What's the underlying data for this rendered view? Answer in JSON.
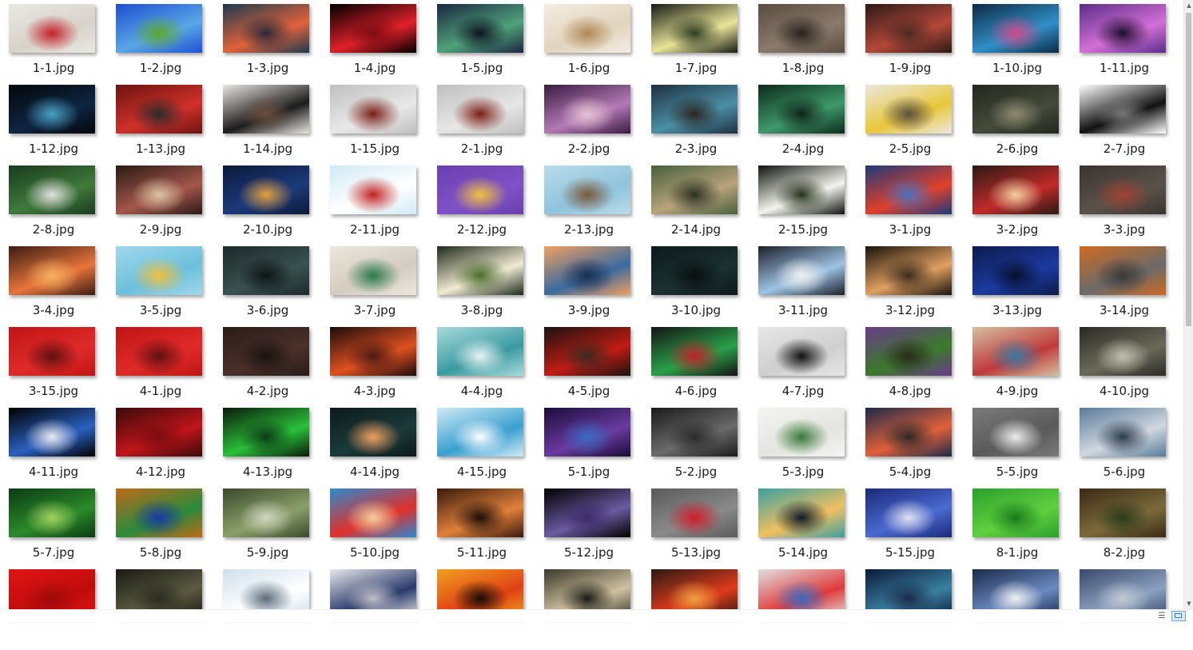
{
  "window": {
    "view": "Large icons"
  },
  "files": [
    {
      "name": "1-1.jpg",
      "colors": [
        "#e9e8e3",
        "#d7d3c9",
        "#c4202a"
      ]
    },
    {
      "name": "1-2.jpg",
      "colors": [
        "#1d4fd3",
        "#5aa6e6",
        "#5ca831"
      ]
    },
    {
      "name": "1-3.jpg",
      "colors": [
        "#1b3a4f",
        "#e0623a",
        "#2a2a3a"
      ]
    },
    {
      "name": "1-4.jpg",
      "colors": [
        "#000000",
        "#e0202a",
        "#7a0d12"
      ]
    },
    {
      "name": "1-5.jpg",
      "colors": [
        "#1a2740",
        "#4fa27a",
        "#0d1320"
      ]
    },
    {
      "name": "1-6.jpg",
      "colors": [
        "#f3ede3",
        "#e2d4bd",
        "#b08a57"
      ]
    },
    {
      "name": "1-7.jpg",
      "colors": [
        "#161b14",
        "#e9e49a",
        "#2c3a1f"
      ]
    },
    {
      "name": "1-8.jpg",
      "colors": [
        "#5a4b40",
        "#8a7a6c",
        "#2a221c"
      ]
    },
    {
      "name": "1-9.jpg",
      "colors": [
        "#2b1a14",
        "#b5473a",
        "#4a2a22"
      ]
    },
    {
      "name": "1-10.jpg",
      "colors": [
        "#0e2a44",
        "#2f8fc7",
        "#d04a8a"
      ]
    },
    {
      "name": "1-11.jpg",
      "colors": [
        "#5c2d8a",
        "#d36fd6",
        "#1c0d2a"
      ]
    },
    {
      "name": "1-12.jpg",
      "colors": [
        "#04060c",
        "#0e2540",
        "#4aa0c6"
      ]
    },
    {
      "name": "1-13.jpg",
      "colors": [
        "#6a1410",
        "#d2302a",
        "#2a2a2a"
      ]
    },
    {
      "name": "1-14.jpg",
      "colors": [
        "#e9e6e1",
        "#1c1c1c",
        "#6a5040"
      ]
    },
    {
      "name": "1-15.jpg",
      "colors": [
        "#bfbfbf",
        "#e8e8e8",
        "#7a1c14"
      ]
    },
    {
      "name": "2-1.jpg",
      "colors": [
        "#bfbfbf",
        "#e6e6e6",
        "#7a1c14"
      ]
    },
    {
      "name": "2-2.jpg",
      "colors": [
        "#3a1a40",
        "#b37ab5",
        "#e6c2d4"
      ]
    },
    {
      "name": "2-3.jpg",
      "colors": [
        "#1d3040",
        "#4b8fa6",
        "#2a2520"
      ]
    },
    {
      "name": "2-4.jpg",
      "colors": [
        "#0c2a1c",
        "#3d9a6a",
        "#10231a"
      ]
    },
    {
      "name": "2-5.jpg",
      "colors": [
        "#ece7df",
        "#e8c73a",
        "#5a4f40"
      ]
    },
    {
      "name": "2-6.jpg",
      "colors": [
        "#22271f",
        "#454a3a",
        "#8c8a70"
      ]
    },
    {
      "name": "2-7.jpg",
      "colors": [
        "#ffffff",
        "#111111",
        "#777777"
      ]
    },
    {
      "name": "2-8.jpg",
      "colors": [
        "#1a3a20",
        "#3f7a3a",
        "#e0e0e0"
      ]
    },
    {
      "name": "2-9.jpg",
      "colors": [
        "#2a1a14",
        "#a4564a",
        "#d9c3a2"
      ]
    },
    {
      "name": "2-10.jpg",
      "colors": [
        "#0b1a3a",
        "#1c3a7a",
        "#e0a040"
      ]
    },
    {
      "name": "2-11.jpg",
      "colors": [
        "#cfeaf6",
        "#ffffff",
        "#c02020"
      ]
    },
    {
      "name": "2-12.jpg",
      "colors": [
        "#6a3fb0",
        "#7e52c4",
        "#f0c040"
      ]
    },
    {
      "name": "2-13.jpg",
      "colors": [
        "#b9dcec",
        "#8fc4dc",
        "#7a5a3a"
      ]
    },
    {
      "name": "2-14.jpg",
      "colors": [
        "#48603a",
        "#b7a37c",
        "#2a3020"
      ]
    },
    {
      "name": "2-15.jpg",
      "colors": [
        "#10140e",
        "#f4f4ee",
        "#233018"
      ]
    },
    {
      "name": "3-1.jpg",
      "colors": [
        "#1c3a7a",
        "#e0402a",
        "#4a70c0"
      ]
    },
    {
      "name": "3-2.jpg",
      "colors": [
        "#2a1a14",
        "#c02a2a",
        "#f0d0a0"
      ]
    },
    {
      "name": "3-3.jpg",
      "colors": [
        "#3a3430",
        "#5a524a",
        "#a04030"
      ]
    },
    {
      "name": "3-4.jpg",
      "colors": [
        "#3a1c14",
        "#e8743a",
        "#f4b060"
      ]
    },
    {
      "name": "3-5.jpg",
      "colors": [
        "#9fd8ec",
        "#6cc0dc",
        "#f0c040"
      ]
    },
    {
      "name": "3-6.jpg",
      "colors": [
        "#1c2a2a",
        "#3a5050",
        "#0c1414"
      ]
    },
    {
      "name": "3-7.jpg",
      "colors": [
        "#ece6dc",
        "#d4ccc0",
        "#2a7a4a"
      ]
    },
    {
      "name": "3-8.jpg",
      "colors": [
        "#1e2a1a",
        "#f0ead2",
        "#4a6a2a"
      ]
    },
    {
      "name": "3-9.jpg",
      "colors": [
        "#f0a060",
        "#3a6aa0",
        "#1c3050"
      ]
    },
    {
      "name": "3-10.jpg",
      "colors": [
        "#0c1a1c",
        "#1c3030",
        "#06100e"
      ]
    },
    {
      "name": "3-11.jpg",
      "colors": [
        "#1a1e2a",
        "#9ec4e4",
        "#f0f0f0"
      ]
    },
    {
      "name": "3-12.jpg",
      "colors": [
        "#1a120e",
        "#e0a060",
        "#3a2a1c"
      ]
    },
    {
      "name": "3-13.jpg",
      "colors": [
        "#0c1a4a",
        "#1c3aa0",
        "#06102a"
      ]
    },
    {
      "name": "3-14.jpg",
      "colors": [
        "#d06a20",
        "#6a6a6a",
        "#3a3a3a"
      ]
    },
    {
      "name": "3-15.jpg",
      "colors": [
        "#c01414",
        "#e02a2a",
        "#601010"
      ]
    },
    {
      "name": "4-1.jpg",
      "colors": [
        "#c01414",
        "#e02a2a",
        "#601010"
      ]
    },
    {
      "name": "4-2.jpg",
      "colors": [
        "#2a1c18",
        "#4a302a",
        "#1a1210"
      ]
    },
    {
      "name": "4-3.jpg",
      "colors": [
        "#1a0c0c",
        "#e05020",
        "#4a1a14"
      ]
    },
    {
      "name": "4-4.jpg",
      "colors": [
        "#a8dcdc",
        "#3a9aa0",
        "#e8f4f4"
      ]
    },
    {
      "name": "4-5.jpg",
      "colors": [
        "#1a1210",
        "#c01c14",
        "#3a2a20"
      ]
    },
    {
      "name": "4-6.jpg",
      "colors": [
        "#141414",
        "#2aa04a",
        "#c0202a"
      ]
    },
    {
      "name": "4-7.jpg",
      "colors": [
        "#e6e6e6",
        "#cfcfcf",
        "#111111"
      ]
    },
    {
      "name": "4-8.jpg",
      "colors": [
        "#6a3a8a",
        "#3a7a2a",
        "#2a2a1c"
      ]
    },
    {
      "name": "4-9.jpg",
      "colors": [
        "#d4c0a0",
        "#c03a3a",
        "#3a7aa0"
      ]
    },
    {
      "name": "4-10.jpg",
      "colors": [
        "#2a2a24",
        "#6a6a5a",
        "#c0c0b0"
      ]
    },
    {
      "name": "4-11.jpg",
      "colors": [
        "#000000",
        "#2a60c0",
        "#e8e8f0"
      ]
    },
    {
      "name": "4-12.jpg",
      "colors": [
        "#3a0a0a",
        "#c0141a",
        "#7a0c10"
      ]
    },
    {
      "name": "4-13.jpg",
      "colors": [
        "#0a1a0a",
        "#2ac03a",
        "#0a3a14"
      ]
    },
    {
      "name": "4-14.jpg",
      "colors": [
        "#0c1a1c",
        "#1c3a3a",
        "#f0a060"
      ]
    },
    {
      "name": "4-15.jpg",
      "colors": [
        "#cfeaf6",
        "#3aa0d0",
        "#ffffff"
      ]
    },
    {
      "name": "5-1.jpg",
      "colors": [
        "#1a0c3a",
        "#6a3aa0",
        "#3a6ac0"
      ]
    },
    {
      "name": "5-2.jpg",
      "colors": [
        "#1a1a1a",
        "#6a6a6a",
        "#2a2a2a"
      ]
    },
    {
      "name": "5-3.jpg",
      "colors": [
        "#f4f4f0",
        "#e4e4e0",
        "#3a7a3a"
      ]
    },
    {
      "name": "5-4.jpg",
      "colors": [
        "#1c2a4a",
        "#e0603a",
        "#2a2a2a"
      ]
    },
    {
      "name": "5-5.jpg",
      "colors": [
        "#7a7a7a",
        "#5a5a5a",
        "#eeeeee"
      ]
    },
    {
      "name": "5-6.jpg",
      "colors": [
        "#5a7a9a",
        "#cfd8e0",
        "#2a3a4a"
      ]
    },
    {
      "name": "5-7.jpg",
      "colors": [
        "#0c3a14",
        "#2a8a2a",
        "#a0d060"
      ]
    },
    {
      "name": "5-8.jpg",
      "colors": [
        "#c06a1a",
        "#2a8a3a",
        "#1a3aa0"
      ]
    },
    {
      "name": "5-9.jpg",
      "colors": [
        "#3a4a2a",
        "#8aa06a",
        "#d0d4c0"
      ]
    },
    {
      "name": "5-10.jpg",
      "colors": [
        "#2a8ad0",
        "#e0302a",
        "#f4d0a0"
      ]
    },
    {
      "name": "5-11.jpg",
      "colors": [
        "#3a1a0c",
        "#e0803a",
        "#1a0c06"
      ]
    },
    {
      "name": "5-12.jpg",
      "colors": [
        "#000000",
        "#6a5aa0",
        "#3a2a6a"
      ]
    },
    {
      "name": "5-13.jpg",
      "colors": [
        "#5a5a5a",
        "#8a8a8a",
        "#d01a2a"
      ]
    },
    {
      "name": "5-14.jpg",
      "colors": [
        "#3aa0a0",
        "#f0c060",
        "#0c1a2a"
      ]
    },
    {
      "name": "5-15.jpg",
      "colors": [
        "#1a2a7a",
        "#4a6ad0",
        "#e0e0f0"
      ]
    },
    {
      "name": "8-1.jpg",
      "colors": [
        "#2aa02a",
        "#60d040",
        "#1a7a1a"
      ]
    },
    {
      "name": "8-2.jpg",
      "colors": [
        "#3a2a14",
        "#7a6a3a",
        "#2a3a1a"
      ]
    },
    {
      "name": "",
      "colors": [
        "#e01414",
        "#c00c0c",
        "#a00a0a"
      ]
    },
    {
      "name": "",
      "colors": [
        "#1a1a14",
        "#5a5a40",
        "#2a2a20"
      ]
    },
    {
      "name": "",
      "colors": [
        "#cfe0ec",
        "#ffffff",
        "#5a6a7a"
      ]
    },
    {
      "name": "",
      "colors": [
        "#e8e8ec",
        "#2a3a6a",
        "#c0c0c8"
      ]
    },
    {
      "name": "",
      "colors": [
        "#f0a020",
        "#e04014",
        "#1a0c06"
      ]
    },
    {
      "name": "",
      "colors": [
        "#3a3a2a",
        "#d0c0a0",
        "#1a1a14"
      ]
    },
    {
      "name": "",
      "colors": [
        "#2a1a14",
        "#e03a1a",
        "#f0a040"
      ]
    },
    {
      "name": "",
      "colors": [
        "#e0e0e0",
        "#e03a3a",
        "#3a6ac0"
      ]
    },
    {
      "name": "",
      "colors": [
        "#0c1a3a",
        "#3a80a0",
        "#1a2a4a"
      ]
    },
    {
      "name": "",
      "colors": [
        "#1a2a4a",
        "#6a8ac0",
        "#f0f0f0"
      ]
    },
    {
      "name": "",
      "colors": [
        "#3a4a6a",
        "#8aa0c0",
        "#c0c8d4"
      ]
    }
  ]
}
